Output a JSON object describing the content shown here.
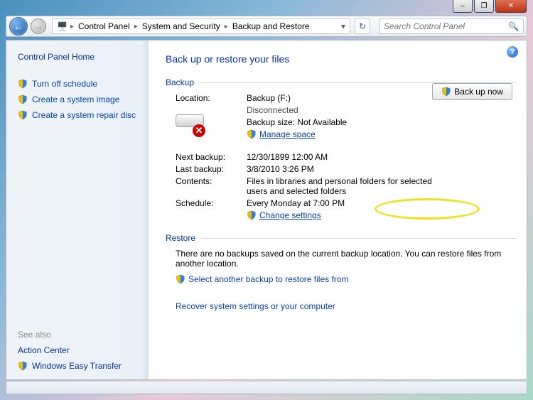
{
  "title_buttons": {
    "min": "–",
    "max": "❐",
    "close": "✕"
  },
  "breadcrumb": {
    "segs": [
      "Control Panel",
      "System and Security",
      "Backup and Restore"
    ]
  },
  "search": {
    "placeholder": "Search Control Panel"
  },
  "sidebar": {
    "home": "Control Panel Home",
    "tasks": [
      "Turn off schedule",
      "Create a system image",
      "Create a system repair disc"
    ],
    "see_also_label": "See also",
    "see_also": [
      "Action Center",
      "Windows Easy Transfer"
    ]
  },
  "main": {
    "heading": "Back up or restore your files",
    "backup_section": "Backup",
    "backup_button": "Back up now",
    "location_label": "Location:",
    "location_value": "Backup (F:)",
    "location_status": "Disconnected",
    "backup_size": "Backup size: Not Available",
    "manage_space": "Manage space",
    "next_backup_label": "Next backup:",
    "next_backup_value": "12/30/1899 12:00 AM",
    "last_backup_label": "Last backup:",
    "last_backup_value": "3/8/2010 3:26 PM",
    "contents_label": "Contents:",
    "contents_value": "Files in libraries and personal folders for selected users and selected folders",
    "schedule_label": "Schedule:",
    "schedule_value": "Every Monday at 7:00 PM",
    "change_settings": "Change settings",
    "restore_section": "Restore",
    "restore_text": "There are no backups saved on the current backup location. You can restore files from another location.",
    "restore_link": "Select another backup to restore files from",
    "recover_link": "Recover system settings or your computer"
  }
}
